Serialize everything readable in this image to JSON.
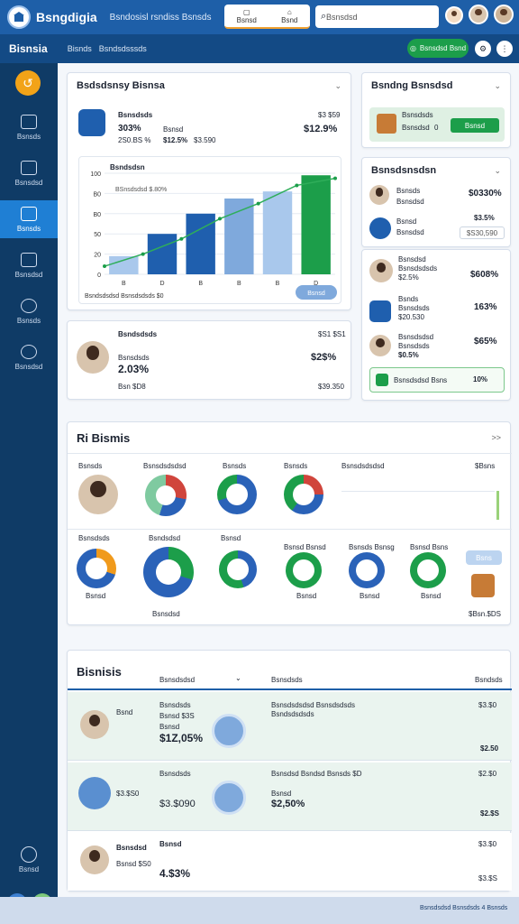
{
  "header": {
    "app_title": "Bsngdigia",
    "nav_text": "Bsndosisl rsndiss Bsnsds",
    "search_placeholder": "Bsnsdsd",
    "tab1": "Bsnsd",
    "tab2": "Bsnd"
  },
  "subbar": {
    "brand": "Bisnsia",
    "crumb1": "Bisnds",
    "crumb2": "Bsndsdsssds",
    "green_button": "Bsnsdsd Bsnd"
  },
  "sidebar": {
    "items": [
      {
        "label": "Bsnsds"
      },
      {
        "label": "Bsnsdsd"
      },
      {
        "label": "Bsnsds"
      },
      {
        "label": "Bsnsdsd"
      },
      {
        "label": "Bsnsds"
      },
      {
        "label": "Bsnsdsd"
      }
    ],
    "bottom_label": "Bsnsd"
  },
  "overview": {
    "title": "Bsdsdsnsy Bisnsa",
    "entity_name": "Bsnsdsds",
    "entity_pct": "303%",
    "entity_sub": "2S0.BS %",
    "entity_sub2": "Bsnsd",
    "entity_pct2": "$12.5%",
    "entity_amt": "$3.590",
    "right_label": "$3 $59",
    "right_pct": "$12.9%"
  },
  "chart_data": {
    "type": "bar",
    "title": "Bsndsdsn",
    "subtitle": "BSnsdsdsd $.80%",
    "categories": [
      "B",
      "D",
      "B",
      "B",
      "B",
      "D"
    ],
    "values": [
      18,
      40,
      60,
      75,
      82,
      98
    ],
    "line": [
      8,
      20,
      35,
      55,
      70,
      88,
      95
    ],
    "yticks": [
      "100",
      "B0",
      "B0",
      "50",
      "20",
      "0"
    ],
    "footer_note": "Bsndsdsdsd Bsnsdsdsds $0",
    "button_label": "Bsnsd"
  },
  "profile_card": {
    "name": "Bsndsdsds",
    "right_label": "$S1 $S1",
    "sub": "Bsnsdsds",
    "pct": "2.03%",
    "pct_right": "$2$%",
    "foot_left": "Bsn $D8",
    "foot_right": "$39.350"
  },
  "balance": {
    "title": "Bsndng Bsnsdsd",
    "label": "Bsnsdsds",
    "label2": "Bsnsdsd",
    "value": "0",
    "button": "Bsnsd"
  },
  "transactions": {
    "title": "Bsnsdsnsdsn",
    "rows": [
      {
        "name": "Bsnsds",
        "sub": "Bsnsdsd",
        "value": "$0330%",
        "color": "green"
      },
      {
        "name": "Bsnsd",
        "sub": "Bsnsdsd",
        "value": "$3.5%",
        "color": "green"
      },
      {
        "name": "",
        "sub": "",
        "value": "$S30,590",
        "color": "muted"
      }
    ]
  },
  "side_list": {
    "rows": [
      {
        "name": "Bsnsdsd",
        "sub": "Bsnsdsdsds",
        "pct": "$2.5%",
        "value": "$608%",
        "color": "orange"
      },
      {
        "name": "Bsnds",
        "sub": "Bsnsdsds",
        "pct": "$20.530",
        "value": "163%",
        "color": "green"
      },
      {
        "name": "Bsnsdsdsd",
        "sub": "Bsnsdsds",
        "pct": "$0.5%",
        "value": "$65%",
        "color": "green"
      }
    ],
    "footer_label": "Bsnsdsdsd Bsns",
    "footer_value": "10%"
  },
  "middle": {
    "title": "Ri Bismis",
    "chev": ">>",
    "row1_labels": [
      "Bsnsds",
      "Bsnsdsdsdsd",
      "Bsnsds",
      "Bsnsds",
      "Bsnsdsdsdsd",
      "$Bsns"
    ],
    "row2_labels": [
      "Bsnsdsds",
      "Bsndsdsd",
      "Bsnsd",
      "Bsnsd Bsnsd",
      "Bsnsds Bsnsg",
      "Bsnsd Bsns"
    ],
    "row2_sub": [
      "Bsnsd",
      "",
      "",
      "Bsnsd",
      "Bsnsd",
      "Bsnsd"
    ],
    "side_btn": "Bsns",
    "foot_left": "Bsnsdsd",
    "foot_right": "$Bsn.$DS"
  },
  "bottom": {
    "title": "Bisnisis",
    "col1": "Bsnsdsdsd",
    "col2": "Bsnsdsds",
    "col3": "Bsndsds",
    "rows": [
      {
        "name": "Bsnd",
        "sub": "Bsnsd",
        "extra": "Bsnsd $3S",
        "label": "Bsnsdsds",
        "pct": "$1Z,05%",
        "desc": "Bsnsdsdsdsd Bsnsdsdsds",
        "desc2": "Bsndsdsdsds",
        "r1": "$3.$0",
        "r2": "$2.50",
        "pct_color": "green"
      },
      {
        "name": "",
        "sub": "",
        "extra": "$3.$S0",
        "label": "Bsnsdsds",
        "pct": "$3.$090",
        "desc": "Bsnsdsd Bsndsd Bsnsds $D",
        "desc2": "Bsnsd",
        "r1": "$2.$0",
        "r2": "$2.$S",
        "val": "$2,50%",
        "pct_color": "muted"
      },
      {
        "name": "Bsnsdsd",
        "sub": "Bsnsd $S0",
        "extra": "",
        "label": "Bsnsd",
        "pct": "4.$3%",
        "desc": "",
        "desc2": "",
        "r1": "$3.$0",
        "r2": "$3.$S",
        "pct_color": "muted"
      }
    ]
  },
  "footer": {
    "text": "Bsnsdsdsd Bsnsdsds 4 Bsnsds"
  }
}
